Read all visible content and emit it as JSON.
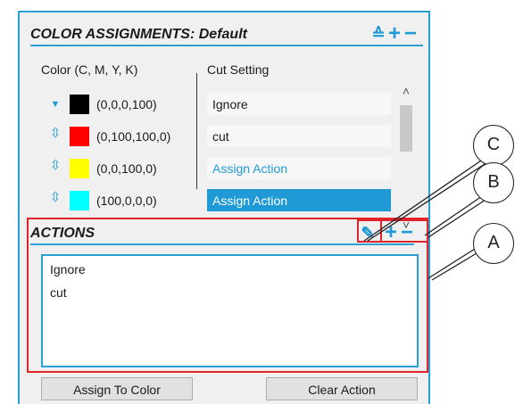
{
  "color_assignments": {
    "title": "COLOR ASSIGNMENTS: Default",
    "header_icons": {
      "sort": "≙",
      "add": "+",
      "remove": "−"
    },
    "col_color": "Color (C, M, Y, K)",
    "col_cut": "Cut Setting",
    "rows": [
      {
        "arrow": "▼",
        "swatch": "#000000",
        "cmyk": "(0,0,0,100)",
        "cut": "Ignore"
      },
      {
        "arrow": "⇳",
        "swatch": "#ff0000",
        "cmyk": "(0,100,100,0)",
        "cut": "cut"
      },
      {
        "arrow": "⇳",
        "swatch": "#ffff00",
        "cmyk": "(0,0,100,0)",
        "cut": "Assign Action"
      },
      {
        "arrow": "⇳",
        "swatch": "#00ffff",
        "cmyk": "(100,0,0,0)",
        "cut": "Assign Action"
      }
    ],
    "scroll_up": "˄",
    "scroll_down": "˅"
  },
  "actions": {
    "title": "ACTIONS",
    "header_icons": {
      "edit": "✎",
      "add": "+",
      "remove": "−"
    },
    "items": [
      "Ignore",
      "cut"
    ]
  },
  "buttons": {
    "assign": "Assign To Color",
    "clear": "Clear Action"
  },
  "callouts": [
    "A",
    "B",
    "C"
  ],
  "colors": {
    "accent": "#1f9ad6",
    "highlight": "#e0242a"
  }
}
